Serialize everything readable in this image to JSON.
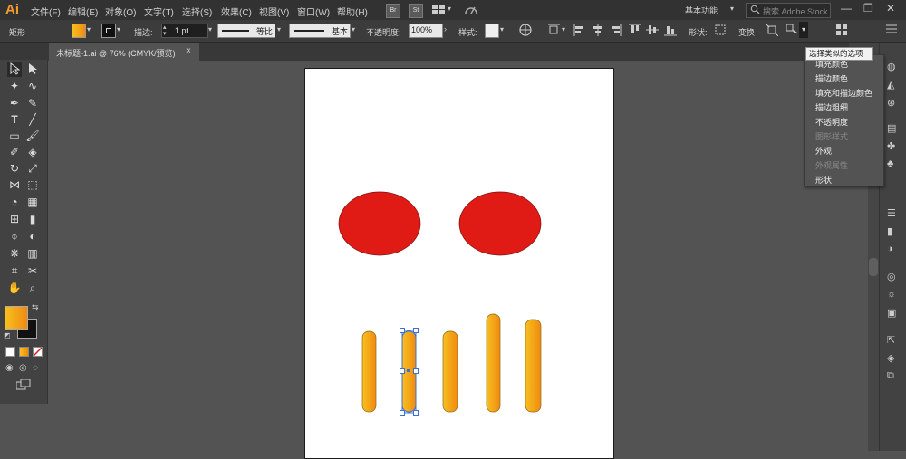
{
  "app": {
    "logo": "Ai"
  },
  "menu": [
    "文件(F)",
    "编辑(E)",
    "对象(O)",
    "文字(T)",
    "选择(S)",
    "效果(C)",
    "视图(V)",
    "窗口(W)",
    "帮助(H)"
  ],
  "menubar_buttons": {
    "bridge": "Br",
    "stock": "St"
  },
  "workspace": "基本功能",
  "search": {
    "placeholder": "搜索 Adobe Stock"
  },
  "control": {
    "object_type": "矩形",
    "stroke_label": "描边:",
    "stroke_weight": "1 pt",
    "stroke_profile": "等比",
    "brush": "基本",
    "opacity_label": "不透明度:",
    "opacity_value": "100%",
    "style_label": "样式:",
    "shape_label": "形状:",
    "transform_label": "变换"
  },
  "document_tab": {
    "title": "未标题-1.ai @ 76% (CMYK/预览)",
    "close": "×"
  },
  "tooltip": "选择类似的选项",
  "dropdown": {
    "items": [
      {
        "label": "填充颜色",
        "enabled": true
      },
      {
        "label": "描边颜色",
        "enabled": true
      },
      {
        "label": "填充和描边颜色",
        "enabled": true
      },
      {
        "label": "描边粗细",
        "enabled": true
      },
      {
        "label": "不透明度",
        "enabled": true
      },
      {
        "label": "图形样式",
        "enabled": false
      },
      {
        "label": "外观",
        "enabled": true
      },
      {
        "label": "外观属性",
        "enabled": false
      },
      {
        "label": "形状",
        "enabled": true
      }
    ]
  },
  "colors": {
    "fill_gradient_start": "#f7c020",
    "fill_gradient_end": "#f08a10",
    "ellipse_fill": "#e01b16",
    "selection": "#3b6fd8",
    "ui_dark": "#323232",
    "ui_mid": "#535353"
  },
  "artwork": {
    "ellipses": [
      {
        "name": "left-eye"
      },
      {
        "name": "right-eye"
      }
    ],
    "bars": [
      {
        "name": "bar-1",
        "selected": false
      },
      {
        "name": "bar-2",
        "selected": true
      },
      {
        "name": "bar-3",
        "selected": false
      },
      {
        "name": "bar-4",
        "selected": false
      },
      {
        "name": "bar-5",
        "selected": false
      }
    ]
  }
}
